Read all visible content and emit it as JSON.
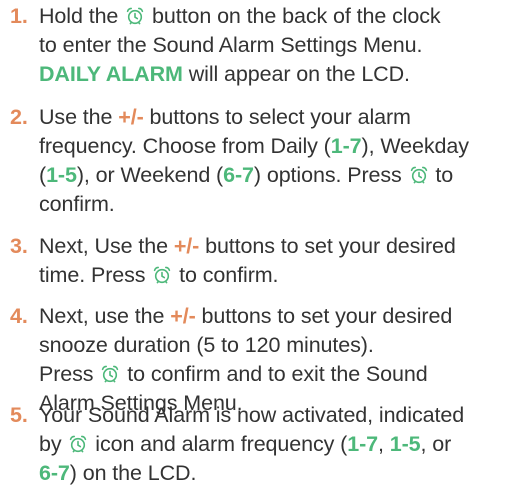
{
  "steps": [
    {
      "number": "1.",
      "lines": [
        [
          {
            "t": "Hold the "
          },
          {
            "icon": "alarm-clock-icon"
          },
          {
            "t": " button on the back of the clock"
          }
        ],
        [
          {
            "t": "to enter the Sound Alarm Settings Menu."
          }
        ],
        [
          {
            "t": "DAILY ALARM",
            "s": "g"
          },
          {
            "t": " will appear on the LCD."
          }
        ]
      ]
    },
    {
      "number": "2.",
      "lines": [
        [
          {
            "t": "Use the "
          },
          {
            "t": "+/-",
            "s": "o"
          },
          {
            "t": " buttons to select your alarm"
          }
        ],
        [
          {
            "t": "frequency. Choose from Daily ("
          },
          {
            "t": "1-7",
            "s": "g"
          },
          {
            "t": "), Weekday"
          }
        ],
        [
          {
            "t": "("
          },
          {
            "t": "1-5",
            "s": "g"
          },
          {
            "t": "), or Weekend ("
          },
          {
            "t": "6-7",
            "s": "g"
          },
          {
            "t": ") options. Press "
          },
          {
            "icon": "alarm-clock-icon"
          },
          {
            "t": " to"
          }
        ],
        [
          {
            "t": "confirm."
          }
        ]
      ]
    },
    {
      "number": "3.",
      "lines": [
        [
          {
            "t": "Next, Use the "
          },
          {
            "t": "+/-",
            "s": "o"
          },
          {
            "t": " buttons to set your desired"
          }
        ],
        [
          {
            "t": "time. Press "
          },
          {
            "icon": "alarm-clock-icon"
          },
          {
            "t": " to confirm."
          }
        ]
      ]
    },
    {
      "number": "4.",
      "lines": [
        [
          {
            "t": "Next, use the "
          },
          {
            "t": "+/-",
            "s": "o"
          },
          {
            "t": " buttons to set your desired"
          }
        ],
        [
          {
            "t": "snooze duration (5 to 120 minutes)."
          }
        ],
        [
          {
            "t": "Press "
          },
          {
            "icon": "alarm-clock-icon"
          },
          {
            "t": " to confirm and to exit the Sound"
          }
        ],
        [
          {
            "t": "Alarm Settings Menu."
          }
        ]
      ]
    },
    {
      "number": "5.",
      "lines": [
        [
          {
            "t": "Your Sound Alarm is now activated, indicated"
          }
        ],
        [
          {
            "t": "by "
          },
          {
            "icon": "alarm-clock-icon"
          },
          {
            "t": " icon and alarm frequency ("
          },
          {
            "t": "1-7",
            "s": "g"
          },
          {
            "t": ", "
          },
          {
            "t": "1-5",
            "s": "g"
          },
          {
            "t": ", or"
          }
        ],
        [
          {
            "t": "6-7",
            "s": "g"
          },
          {
            "t": ") on the LCD."
          }
        ]
      ]
    }
  ],
  "colors": {
    "number": "#e38a5b",
    "plus_minus": "#e38a5b",
    "highlight_green": "#4db87a",
    "icon": "#4db87a",
    "body_text": "#333333"
  }
}
